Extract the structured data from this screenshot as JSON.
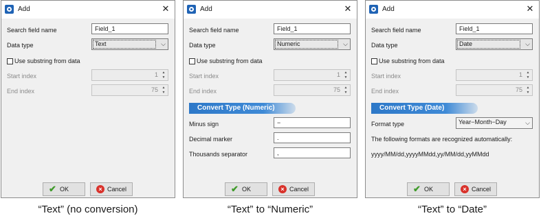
{
  "dialog_title": "Add",
  "labels": {
    "search_field_name": "Search field name",
    "data_type": "Data type",
    "use_substring": "Use substring from data",
    "start_index": "Start index",
    "end_index": "End index"
  },
  "buttons": {
    "ok": "OK",
    "cancel": "Cancel"
  },
  "dialogs": [
    {
      "field_value": "Field_1",
      "data_type": "Text",
      "start_index": "1",
      "end_index": "75",
      "caption": "“Text” (no conversion)"
    },
    {
      "field_value": "Field_1",
      "data_type": "Numeric",
      "start_index": "1",
      "end_index": "75",
      "section_title": "Convert Type (Numeric)",
      "minus_sign_label": "Minus sign",
      "minus_sign_value": "−",
      "decimal_marker_label": "Decimal marker",
      "decimal_marker_value": ".",
      "thousands_separator_label": "Thousands separator",
      "thousands_separator_value": ",",
      "caption": "“Text” to “Numeric”"
    },
    {
      "field_value": "Field_1",
      "data_type": "Date",
      "start_index": "1",
      "end_index": "75",
      "section_title": "Convert Type (Date)",
      "format_type_label": "Format type",
      "format_type_value": "Year−Month−Day",
      "formats_note": "The following formats are recognized automatically:",
      "formats_list": "yyyy/MM/dd,yyyyMMdd,yy/MM/dd,yyMMdd",
      "caption": "“Text” to “Date”"
    }
  ],
  "colors": {
    "section_header": "#2d78c8",
    "ok_check": "#3f9a2a",
    "cancel_icon": "#d9322b"
  }
}
